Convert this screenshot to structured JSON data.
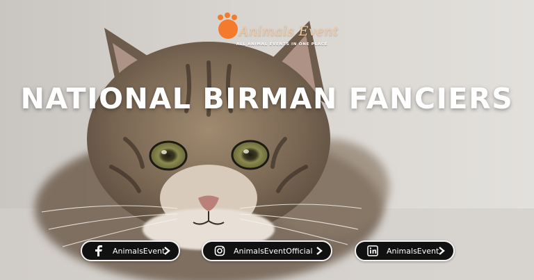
{
  "logo": {
    "name": "Animals Event",
    "tagline": "ALL ANIMAL EVENTS IN ONE PLACE",
    "accent_color": "#f47b2e"
  },
  "headline": "NATIONAL BIRMAN FANCIERS",
  "social": [
    {
      "icon": "facebook-icon",
      "label": "AnimalsEvent"
    },
    {
      "icon": "instagram-icon",
      "label": "AnimalsEventOfficial"
    },
    {
      "icon": "linkedin-icon",
      "label": "AnimalsEvent"
    }
  ],
  "photo": {
    "subject": "tabby-kitten"
  }
}
